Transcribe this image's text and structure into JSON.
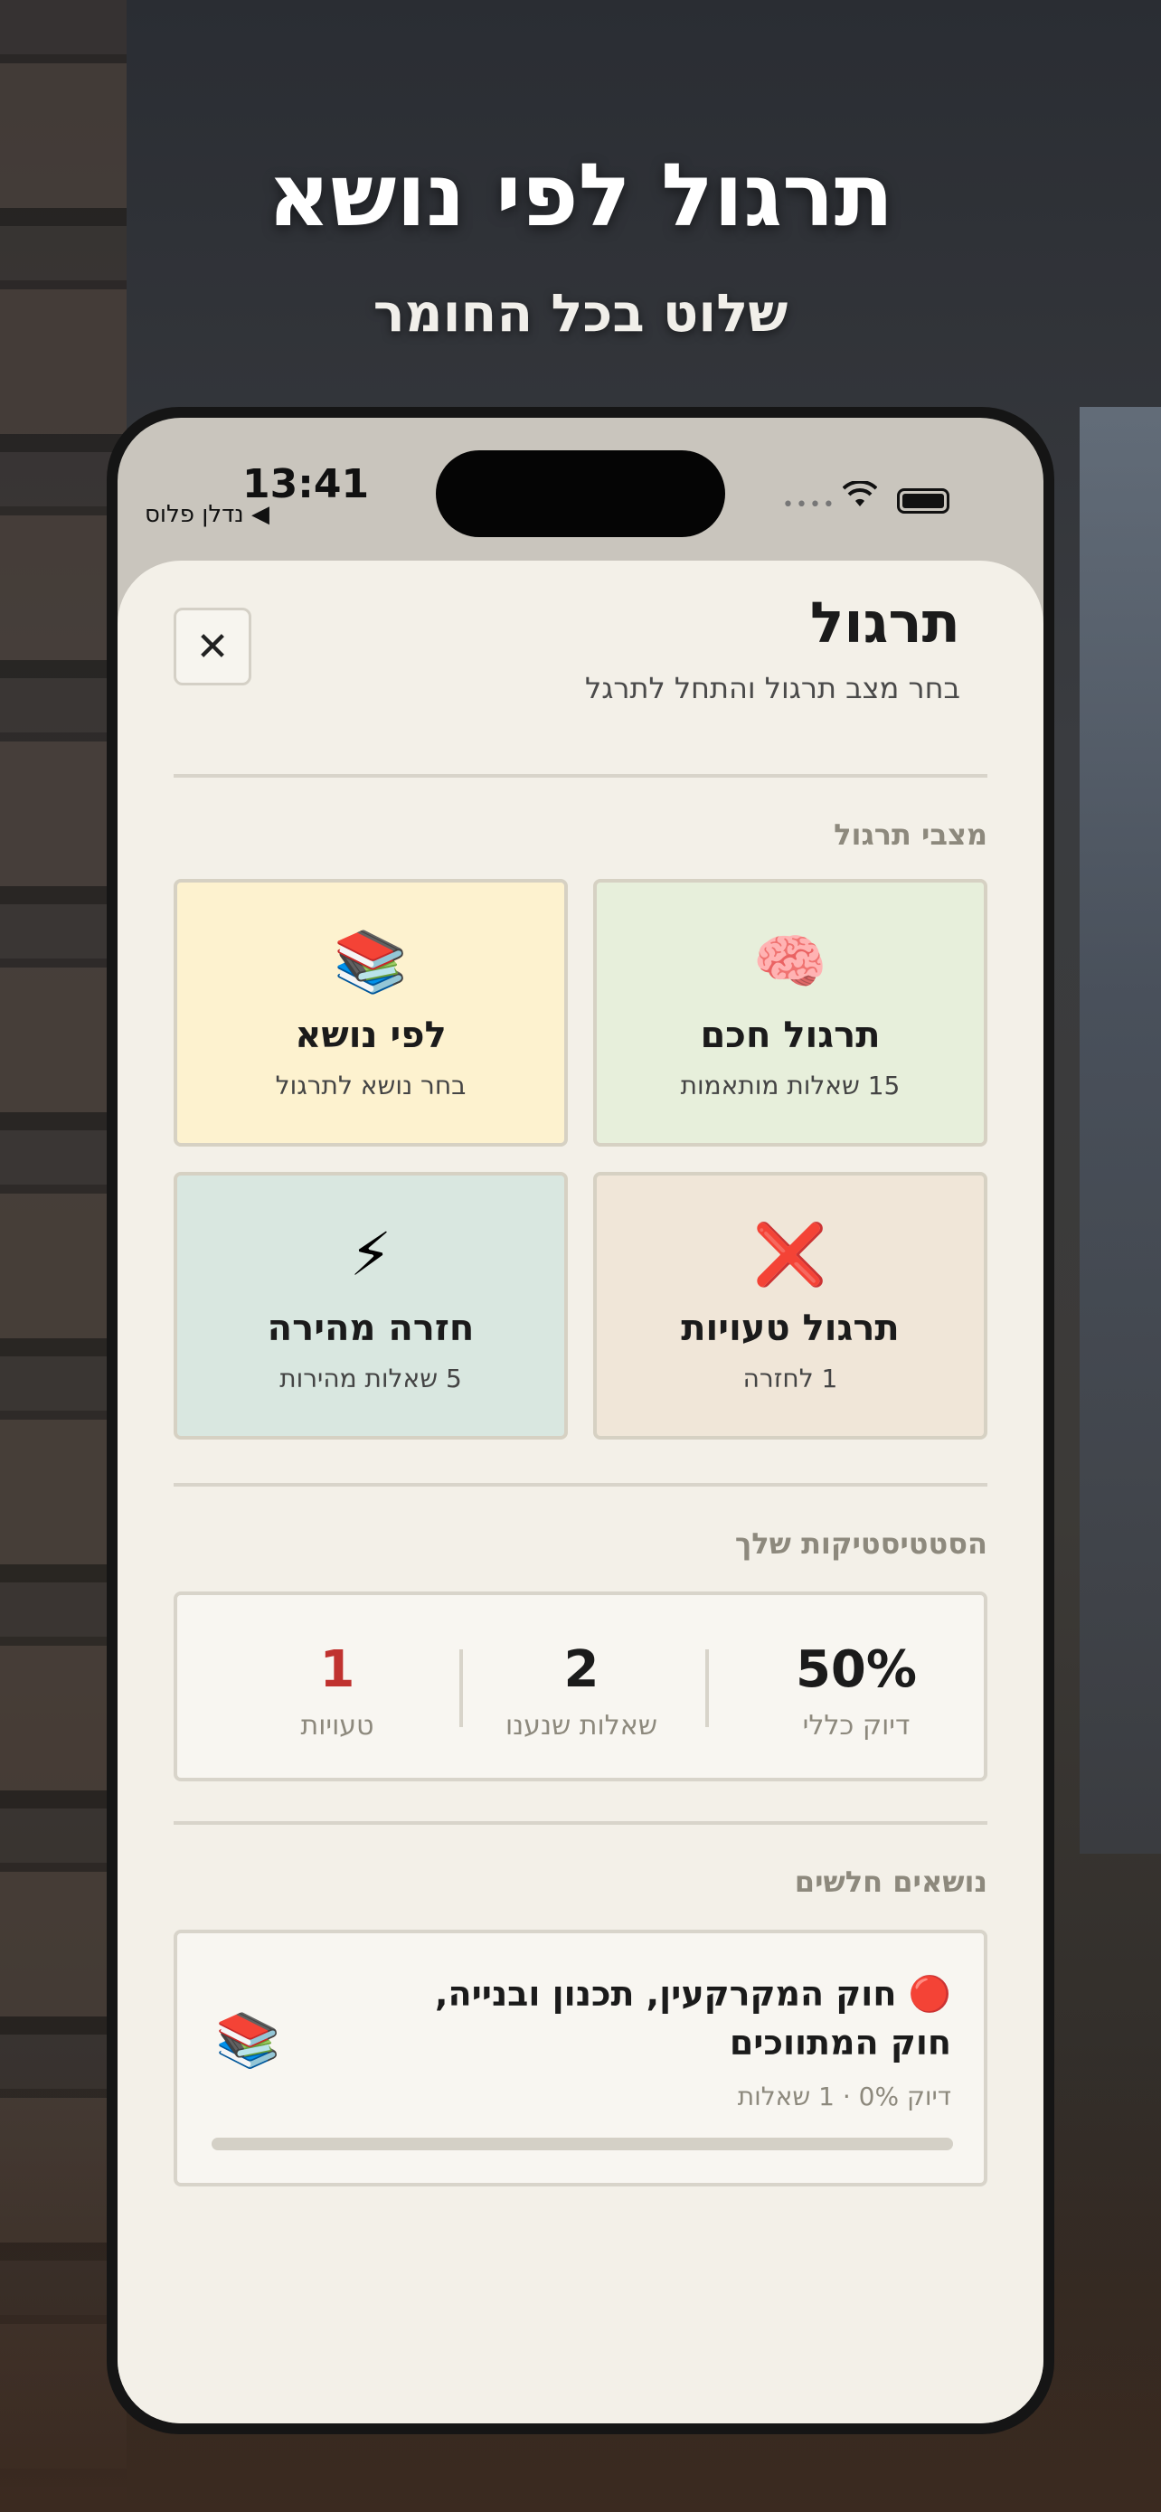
{
  "promo": {
    "headline": "תרגול לפי נושא",
    "subline": "שלוט בכל החומר"
  },
  "status_bar": {
    "time": "13:41",
    "back_app": "◀ נדלן פלוס",
    "signal": "••••",
    "wifi_glyph": "◉"
  },
  "header": {
    "close_glyph": "✕",
    "title": "תרגול",
    "subtitle": "בחר מצב תרגול והתחל לתרגל"
  },
  "modes": {
    "label": "מצבי תרגול",
    "items": [
      {
        "icon": "🧠",
        "icon_name": "brain-icon",
        "title": "תרגול חכם",
        "subtitle": "15 שאלות מותאמות",
        "bg": "#e7efdb"
      },
      {
        "icon": "📚",
        "icon_name": "books-icon",
        "title": "לפי נושא",
        "subtitle": "בחר נושא לתרגול",
        "bg": "#fdf2cf"
      },
      {
        "icon": "❌",
        "icon_name": "cross-icon",
        "title": "תרגול טעויות",
        "subtitle": "1 לחזרה",
        "bg": "#f0e6d8"
      },
      {
        "icon": "⚡",
        "icon_name": "lightning-icon",
        "title": "חזרה מהירה",
        "subtitle": "5 שאלות מהירות",
        "bg": "#d9e7e0"
      }
    ]
  },
  "stats": {
    "label": "הסטטיסטיקות שלך",
    "accuracy": {
      "value": "50%",
      "label": "דיוק כללי"
    },
    "answered": {
      "value": "2",
      "label": "שאלות שנענו"
    },
    "mistakes": {
      "value": "1",
      "label": "טעויות",
      "color": "#c0322f"
    }
  },
  "weak_topics": {
    "label": "נושאים חלשים",
    "items": [
      {
        "status_icon": "🔴",
        "icon": "📚",
        "title": "חוק המקרקעין, תכנון ובנייה, חוק המתווכים",
        "meta": "דיוק 0% · 1 שאלות",
        "accuracy_fraction": 0
      }
    ]
  }
}
